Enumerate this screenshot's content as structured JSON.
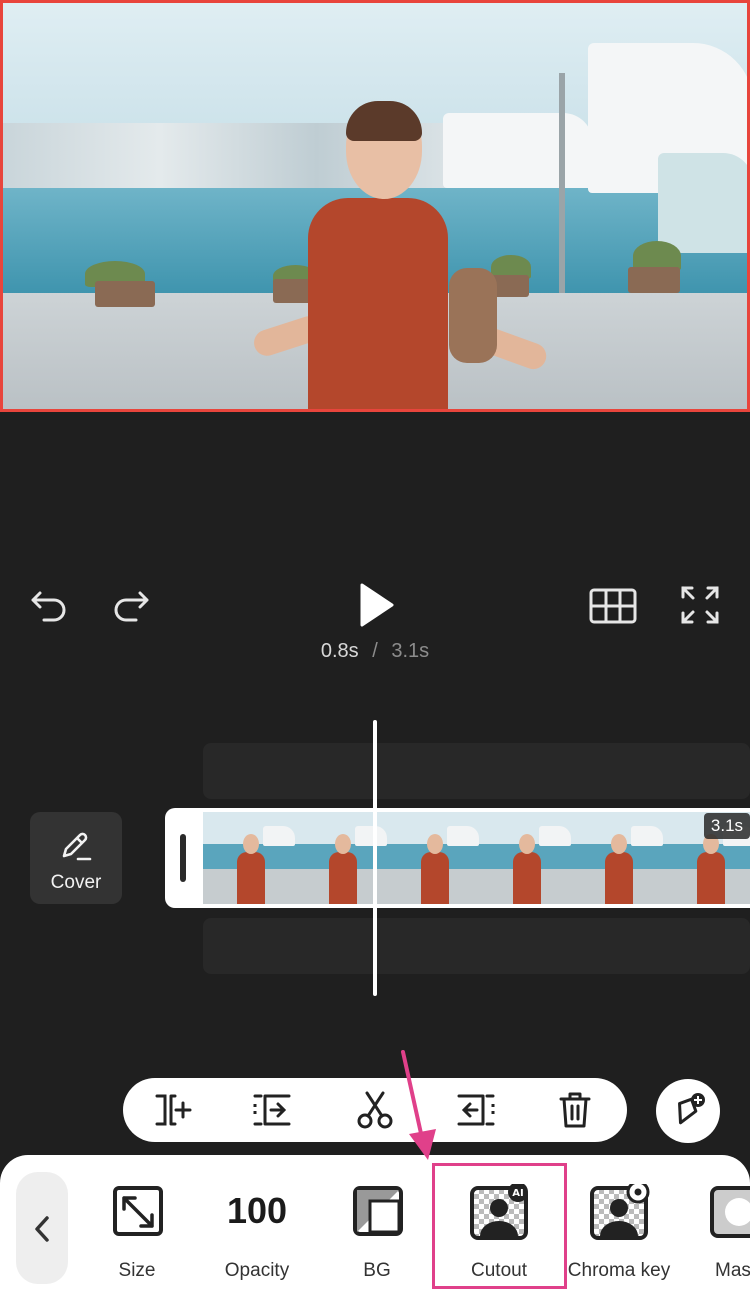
{
  "transport": {
    "current_time": "0.8s",
    "separator": "/",
    "total_time": "3.1s"
  },
  "timeline": {
    "cover_label": "Cover",
    "clip_duration": "3.1s",
    "frame_count": 6
  },
  "toolbar": {
    "tools": [
      {
        "name": "size",
        "label": "Size",
        "icon": "resize-icon"
      },
      {
        "name": "opacity",
        "label": "Opacity",
        "value": "100"
      },
      {
        "name": "bg",
        "label": "BG",
        "icon": "background-icon"
      },
      {
        "name": "cutout",
        "label": "Cutout",
        "icon": "ai-cutout-icon",
        "badge": "AI"
      },
      {
        "name": "chroma-key",
        "label": "Chroma key",
        "icon": "chroma-key-icon"
      },
      {
        "name": "mask",
        "label": "Mas",
        "icon": "mask-icon"
      }
    ]
  },
  "colors": {
    "accent_highlight": "#e0408a",
    "preview_border": "#e8453c",
    "background": "#1f1f1f"
  }
}
